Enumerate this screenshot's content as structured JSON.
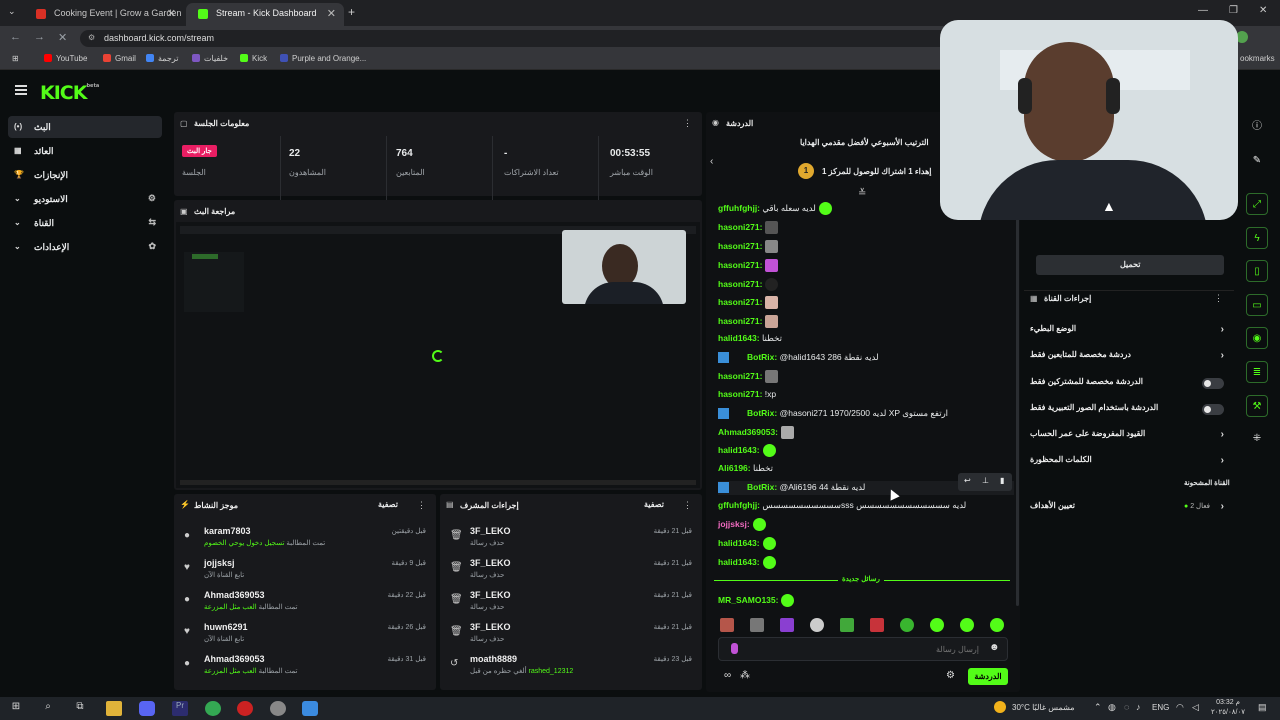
{
  "browser": {
    "tabs": [
      {
        "title": "Cooking Event | Grow a Garden",
        "active": false
      },
      {
        "title": "Stream - Kick Dashboard",
        "active": true
      }
    ],
    "url": "dashboard.kick.com/stream",
    "bookmarks": [
      "YouTube",
      "Gmail",
      "ترجمة",
      "خلفيات",
      "Kick",
      "Purple and Orange..."
    ],
    "bookmarks_right": "ookmarks"
  },
  "kick": {
    "logo": "KICK",
    "logo_sup": "beta"
  },
  "sidebar": {
    "items": [
      {
        "label": "البث",
        "icon": "(•)",
        "active": true
      },
      {
        "label": "العائد",
        "icon": "▦"
      },
      {
        "label": "الإنجازات",
        "icon": "🏆"
      },
      {
        "label": "الاستوديو",
        "icon": "⌄",
        "right": "⚙"
      },
      {
        "label": "القناة",
        "icon": "⌄",
        "right": "⇆"
      },
      {
        "label": "الإعدادات",
        "icon": "⌄",
        "right": "✿"
      }
    ]
  },
  "session": {
    "title": "معلومات الجلسة",
    "live_badge": "جار البث",
    "live_label": "الجلسة",
    "stats": [
      {
        "value": "22",
        "label": "المشاهدون"
      },
      {
        "value": "764",
        "label": "المتابعين"
      },
      {
        "value": "-",
        "label": "تعداد الاشتراكات"
      },
      {
        "value": "00:53:55",
        "label": "الوقت مباشر"
      }
    ]
  },
  "preview": {
    "title": "مراجعة البث"
  },
  "activity": {
    "title": "موجز النشاط",
    "filter": "تصفية",
    "rows": [
      {
        "name": "karam7803",
        "sub_pre": "تمت المطالبة",
        "sub_hl": "تسجيل دخول يوحي الخصوم",
        "time": "قبل دقيقتين",
        "icon": "●"
      },
      {
        "name": "jojjsksj",
        "sub_pre": "تابع القناة الآن",
        "sub_hl": "",
        "time": "قبل 9 دقيقة",
        "icon": "♥"
      },
      {
        "name": "Ahmad369053",
        "sub_pre": "تمت المطالبة",
        "sub_hl": "العب مثل المزرعة",
        "time": "قبل 22 دقيقة",
        "icon": "●"
      },
      {
        "name": "huwn6291",
        "sub_pre": "تابع القناة الآن",
        "sub_hl": "",
        "time": "قبل 26 دقيقة",
        "icon": "♥"
      },
      {
        "name": "Ahmad369053",
        "sub_pre": "تمت المطالبة",
        "sub_hl": "العب مثل المزرعة",
        "time": "قبل 31 دقيقة",
        "icon": "●"
      }
    ]
  },
  "mod": {
    "title": "إجراءات المشرف",
    "filter": "تصفية",
    "rows": [
      {
        "name": "3F_LEKO",
        "sub_pre": "حذف رسالة",
        "sub_hl": "",
        "time": "قبل 21 دقيقة",
        "icon": "🗑"
      },
      {
        "name": "3F_LEKO",
        "sub_pre": "حذف رسالة",
        "sub_hl": "",
        "time": "قبل 21 دقيقة",
        "icon": "🗑"
      },
      {
        "name": "3F_LEKO",
        "sub_pre": "حذف رسالة",
        "sub_hl": "",
        "time": "قبل 21 دقيقة",
        "icon": "🗑"
      },
      {
        "name": "3F_LEKO",
        "sub_pre": "حذف رسالة",
        "sub_hl": "",
        "time": "قبل 21 دقيقة",
        "icon": "🗑"
      },
      {
        "name": "moath8889",
        "sub_pre": "ألغي حظره من قبل",
        "sub_hl": "rashed_12312",
        "time": "قبل 23 دقيقة",
        "icon": "↺"
      }
    ]
  },
  "chat": {
    "title": "الدردشة",
    "leaderboard_title": "الترتيب الأسبوعي لأفضل مقدمي الهدايا",
    "leaderboard_sub": "إهداء 1 اشتراك للوصول للمركز 1",
    "leaderboard_rank": "1",
    "messages": [
      {
        "user": "gffuhfghjj:",
        "text": "لديه سعله باقي",
        "color": "#53fc18",
        "bot": false
      },
      {
        "user": "hasoni271:",
        "text": "",
        "color": "#53fc18",
        "bot": false
      },
      {
        "user": "hasoni271:",
        "text": "",
        "color": "#53fc18",
        "bot": false
      },
      {
        "user": "hasoni271:",
        "text": "",
        "color": "#53fc18",
        "bot": false
      },
      {
        "user": "hasoni271:",
        "text": "",
        "color": "#53fc18",
        "bot": false
      },
      {
        "user": "hasoni271:",
        "text": "",
        "color": "#53fc18",
        "bot": false
      },
      {
        "user": "hasoni271:",
        "text": "",
        "color": "#53fc18",
        "bot": false
      },
      {
        "user": "halid1643:",
        "text": "تخطنا",
        "color": "#53fc18",
        "bot": false
      },
      {
        "user": "BotRix:",
        "text": "@halid1643 286 لديه نقطة",
        "color": "#53fc18",
        "bot": true
      },
      {
        "user": "hasoni271:",
        "text": "",
        "color": "#53fc18",
        "bot": false
      },
      {
        "user": "hasoni271:",
        "text": "!xp",
        "color": "#53fc18",
        "bot": false
      },
      {
        "user": "BotRix:",
        "text": "@hasoni271 1970/2500 لديه XP ارتفع مستوى",
        "color": "#53fc18",
        "bot": true
      },
      {
        "user": "Ahmad369053:",
        "text": "",
        "color": "#53fc18",
        "bot": false
      },
      {
        "user": "halid1643:",
        "text": "",
        "color": "#53fc18",
        "bot": false
      },
      {
        "user": "Ali6196:",
        "text": "تخطنا",
        "color": "#53fc18",
        "bot": false
      },
      {
        "user": "BotRix:",
        "text": "@Ali6196 44 لديه نقطة",
        "color": "#53fc18",
        "bot": true
      },
      {
        "user": "gffuhfghjj:",
        "text": "سسسسسسسسسسsss لديه سسسسسسسسسسسس",
        "color": "#53fc18",
        "bot": false
      },
      {
        "user": "jojjsksj:",
        "text": "",
        "color": "#f06bc0",
        "bot": false
      },
      {
        "user": "halid1643:",
        "text": "",
        "color": "#53fc18",
        "bot": false
      },
      {
        "user": "halid1643:",
        "text": "",
        "color": "#53fc18",
        "bot": false
      }
    ],
    "new_messages": "رسائل جديدة",
    "last_message_user": "MR_SAMO135:",
    "input_placeholder": "إرسال رسالة",
    "send_label": "الدردشة"
  },
  "right_panel": {
    "load_button": "تحميل",
    "actions_title": "إجراءات القناة",
    "rows": [
      {
        "label": "الوضع البطيء",
        "type": "chevron"
      },
      {
        "label": "دردشة مخصصة للمتابعين فقط",
        "type": "chevron"
      },
      {
        "label": "الدردشة مخصصة للمشتركين فقط",
        "type": "toggle"
      },
      {
        "label": "الدردشة باستخدام الصور التعبيرية فقط",
        "type": "toggle"
      },
      {
        "label": "القيود المفروضة على عمر الحساب",
        "type": "chevron"
      },
      {
        "label": "الكلمات المحظورة",
        "type": "chevron"
      }
    ],
    "mod_channel": "القناة المشحونة",
    "goals_label": "تعيين الأهداف",
    "goals_status": "فعال 2"
  },
  "taskbar": {
    "weather": "30°C مشمس غالبًا",
    "lang": "ENG",
    "time": "03:32 م",
    "date": "٢٠٢٥/٠٨/٠٧"
  },
  "colors": {
    "accent": "#53fc18",
    "panel": "#18191c",
    "bg": "#0b0e0f",
    "live": "#e91e63"
  }
}
